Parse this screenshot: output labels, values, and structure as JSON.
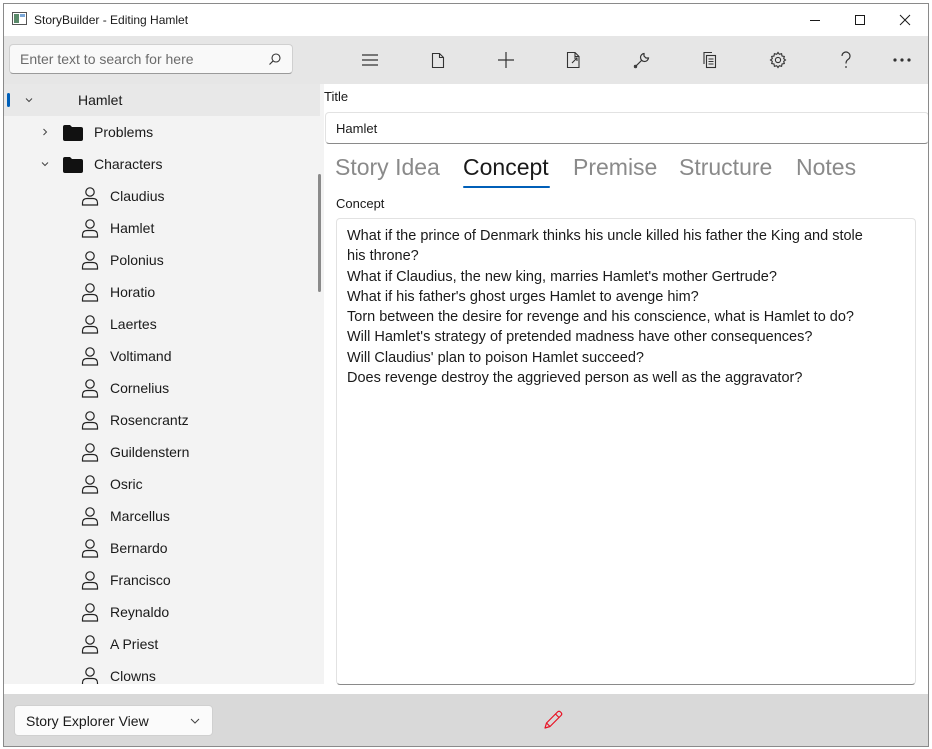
{
  "window": {
    "title": "StoryBuilder - Editing Hamlet"
  },
  "toolbar": {
    "search": {
      "placeholder": "Enter text to search for here",
      "value": ""
    },
    "buttons": [
      "menu-icon",
      "new-file-icon",
      "add-icon",
      "export-icon",
      "wrench-icon",
      "copy-icon",
      "gear-icon",
      "help-icon",
      "more-icon"
    ]
  },
  "tree": {
    "root": {
      "label": "Hamlet",
      "expanded": true,
      "selected": true
    },
    "problems": {
      "label": "Problems",
      "expanded": false
    },
    "characters": {
      "label": "Characters",
      "expanded": true,
      "items": [
        "Claudius",
        "Hamlet",
        "Polonius",
        "Horatio",
        "Laertes",
        "Voltimand",
        "Cornelius",
        "Rosencrantz",
        "Guildenstern",
        "Osric",
        "Marcellus",
        "Bernardo",
        "Francisco",
        "Reynaldo",
        "A Priest",
        "Clowns"
      ]
    }
  },
  "content": {
    "title_label": "Title",
    "title_value": "Hamlet",
    "tabs": [
      {
        "label": "Story Idea",
        "active": false
      },
      {
        "label": "Concept",
        "active": true
      },
      {
        "label": "Premise",
        "active": false
      },
      {
        "label": "Structure",
        "active": false
      },
      {
        "label": "Notes",
        "active": false
      }
    ],
    "concept_label": "Concept",
    "concept_lines": [
      "What if the prince of Denmark thinks his uncle killed his father the King and stole",
      "his throne?",
      "What if Claudius, the new king, marries Hamlet's mother Gertrude?",
      "What if his father's ghost urges Hamlet to avenge him?",
      "Torn between the desire for revenge and his conscience, what is Hamlet to do?",
      "Will Hamlet's strategy of pretended madness have other consequences?",
      "Will Claudius' plan to poison Hamlet succeed?",
      "Does revenge destroy the aggrieved person as well as the aggravator?"
    ]
  },
  "bottombar": {
    "view_select": "Story Explorer View"
  },
  "colors": {
    "accent": "#005fb8",
    "edit_icon": "#e81123",
    "toolbar_bg": "#e6e6e6",
    "tree_bg": "#f3f3f3",
    "bottombar_bg": "#d9d9d9"
  }
}
